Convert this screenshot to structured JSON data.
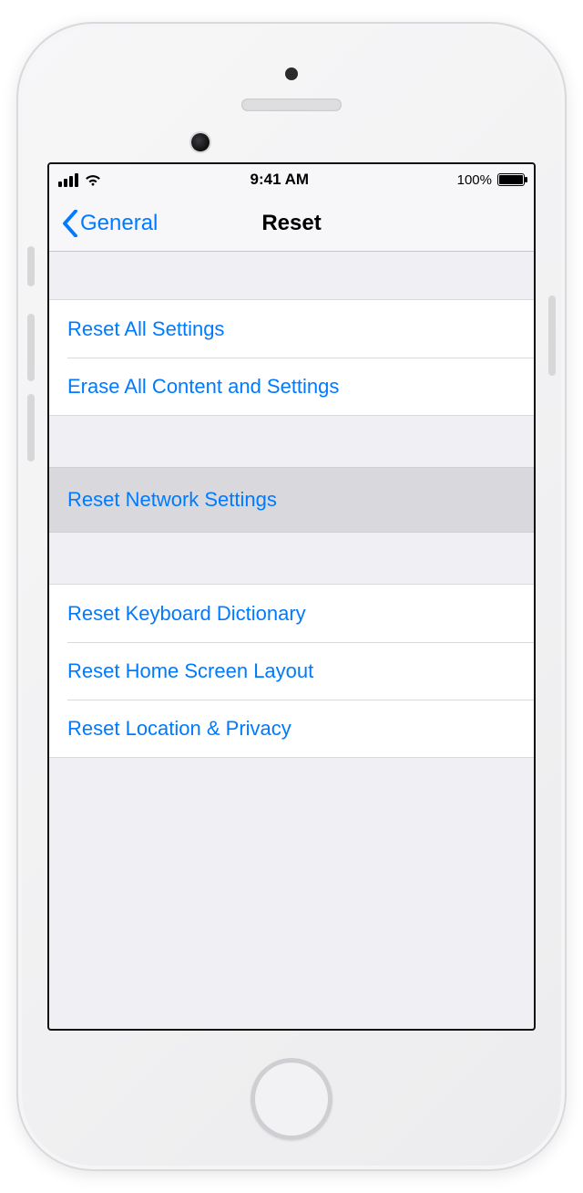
{
  "status": {
    "time": "9:41 AM",
    "battery_percent": "100%"
  },
  "nav": {
    "back_label": "General",
    "title": "Reset"
  },
  "groups": {
    "g1": [
      "Reset All Settings",
      "Erase All Content and Settings"
    ],
    "g2": [
      "Reset Network Settings"
    ],
    "g3": [
      "Reset Keyboard Dictionary",
      "Reset Home Screen Layout",
      "Reset Location & Privacy"
    ]
  },
  "selected": "Reset Network Settings"
}
